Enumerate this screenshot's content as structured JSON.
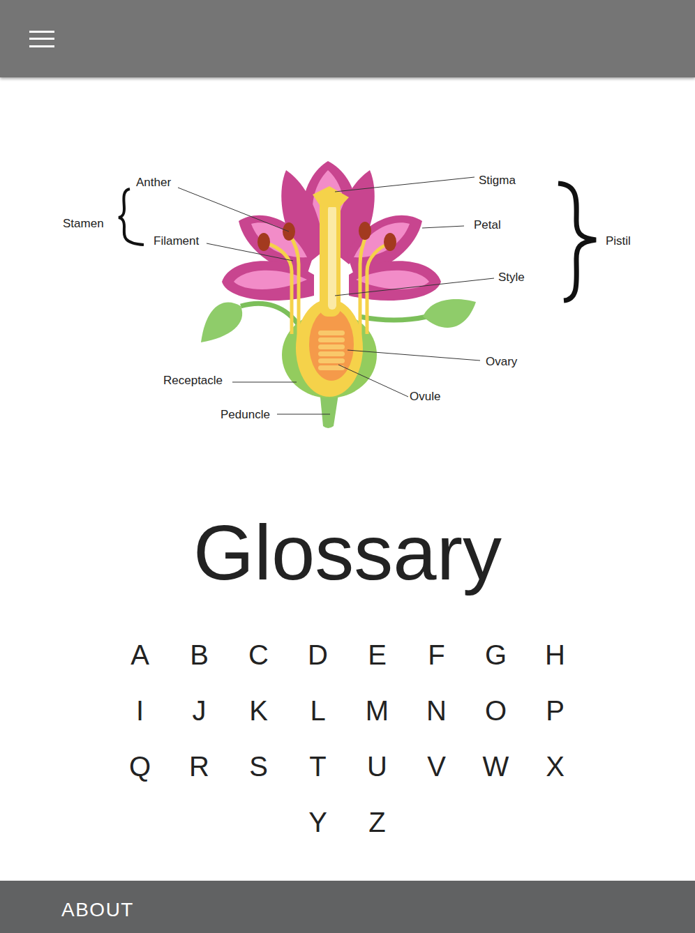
{
  "diagram": {
    "stamen": "Stamen",
    "anther": "Anther",
    "filament": "Filament",
    "stigma": "Stigma",
    "petal": "Petal",
    "style": "Style",
    "pistil": "Pistil",
    "ovary": "Ovary",
    "ovule": "Ovule",
    "receptacle": "Receptacle",
    "peduncle": "Peduncle"
  },
  "glossary": {
    "title": "Glossary",
    "letters": [
      "A",
      "B",
      "C",
      "D",
      "E",
      "F",
      "G",
      "H",
      "I",
      "J",
      "K",
      "L",
      "M",
      "N",
      "O",
      "P",
      "Q",
      "R",
      "S",
      "T",
      "U",
      "V",
      "W",
      "X",
      "Y",
      "Z"
    ]
  },
  "footer": {
    "about": "ABOUT"
  }
}
